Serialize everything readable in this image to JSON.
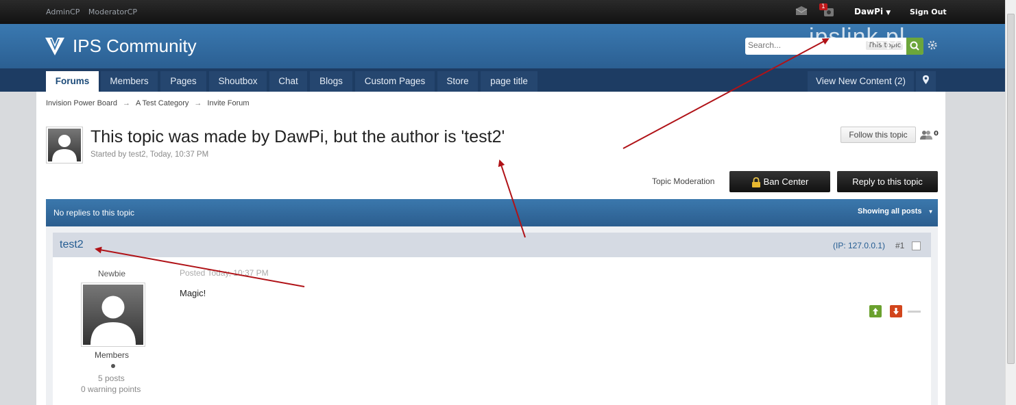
{
  "topbar": {
    "admin_links": [
      "AdminCP",
      "ModeratorCP"
    ],
    "notification_count": "1",
    "user": "DawPi",
    "sign_out": "Sign Out"
  },
  "header": {
    "brand": "IPS Community",
    "search_placeholder": "Search...",
    "search_scope": "This topic",
    "watermark": "ipslink.pl"
  },
  "nav": {
    "tabs": [
      "Forums",
      "Members",
      "Pages",
      "Shoutbox",
      "Chat",
      "Blogs",
      "Custom Pages",
      "Store",
      "page title"
    ],
    "view_new": "View New Content (2)"
  },
  "breadcrumbs": [
    "Invision Power Board",
    "A Test Category",
    "Invite Forum"
  ],
  "topic": {
    "title": "This topic was made by DawPi, but the author is 'test2'",
    "meta": "Started by test2, Today, 10:37 PM",
    "follow": "Follow this topic",
    "followers": "0",
    "moderation": "Topic Moderation",
    "ban_center": "Ban Center",
    "reply": "Reply to this topic"
  },
  "bar": {
    "replies": "No replies to this topic",
    "showing": "Showing all posts"
  },
  "post": {
    "author": "test2",
    "ip": "(IP: 127.0.0.1)",
    "number": "#1",
    "rank": "Newbie",
    "group": "Members",
    "posts": "5 posts",
    "warnings": "0 warning points",
    "posted": "Posted Today, 10:37 PM",
    "body": "Magic!"
  },
  "colors": {
    "header_blue": "#3a79b1",
    "nav_dark": "#1d3c63",
    "link_blue": "#245c92",
    "arrow_red": "#b01217"
  }
}
